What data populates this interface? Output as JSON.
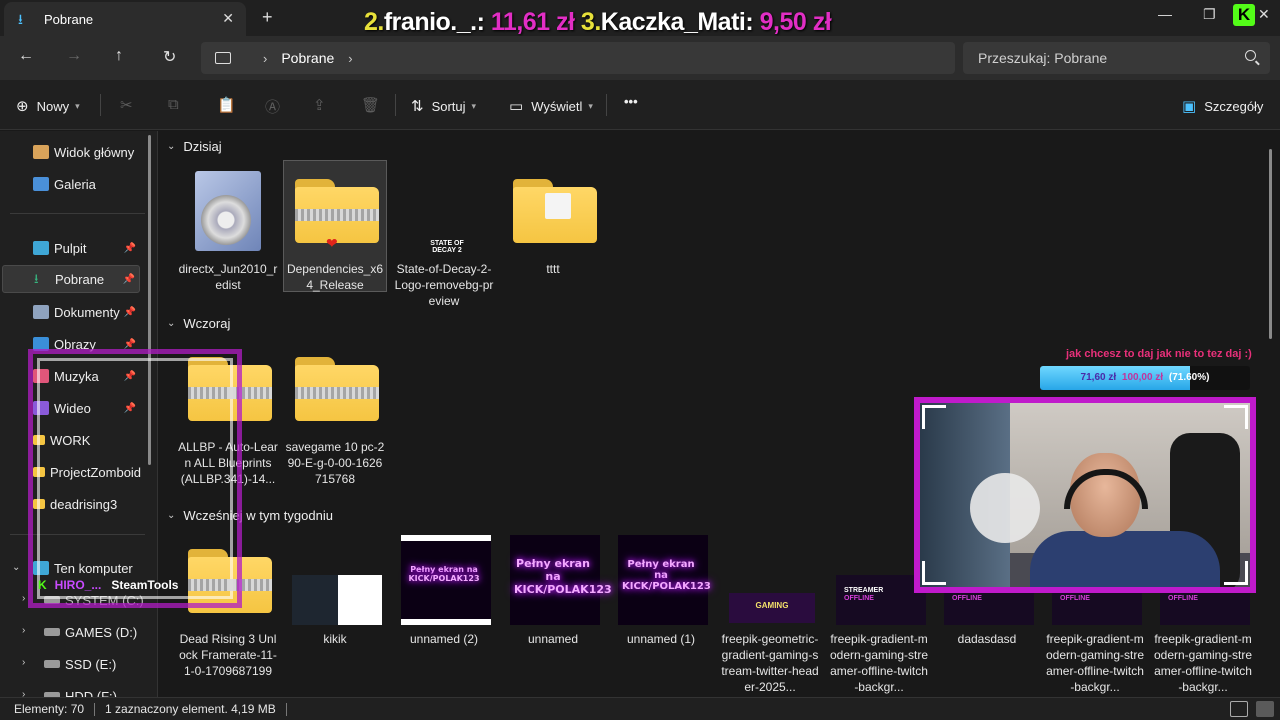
{
  "window": {
    "tab_title": "Pobrane",
    "tab_close": "✕",
    "new_tab": "+"
  },
  "overlay": {
    "donations": [
      {
        "rank": "2.",
        "name": "franio._.:",
        "amount": "11,61 zł"
      },
      {
        "rank": "3.",
        "name": "Kaczka_Mati:",
        "amount": "9,50 zł"
      }
    ],
    "goal_text": "jak chcesz to daj jak nie to tez daj :)",
    "goal_current": "71,60 zł",
    "goal_target": "100,00 zł",
    "goal_percent": "(71.60%)",
    "goal_fraction": 0.716,
    "steam_user": "HIRO_...",
    "steam_label": "SteamTools"
  },
  "address": {
    "crumb": "Pobrane",
    "search_placeholder": "Przeszukaj: Pobrane"
  },
  "toolbar": {
    "new_label": "Nowy",
    "sort_label": "Sortuj",
    "view_label": "Wyświetl",
    "more_label": "•••",
    "details_label": "Szczegóły"
  },
  "sidebar": {
    "items": [
      {
        "label": "Widok główny",
        "icon": "home-icon",
        "color": "#d9a35a"
      },
      {
        "label": "Galeria",
        "icon": "gallery-icon",
        "color": "#4a90d9"
      },
      {
        "label": "Pulpit",
        "icon": "desktop-icon",
        "color": "#3fa7d6",
        "pinned": true
      },
      {
        "label": "Pobrane",
        "icon": "download-icon",
        "color": "#37b37e",
        "pinned": true
      },
      {
        "label": "Dokumenty",
        "icon": "documents-icon",
        "color": "#8fa3bf",
        "pinned": true
      },
      {
        "label": "Obrazy",
        "icon": "pictures-icon",
        "color": "#3a8fd9",
        "pinned": true
      },
      {
        "label": "Muzyka",
        "icon": "music-icon",
        "color": "#e0567a",
        "pinned": true
      },
      {
        "label": "Wideo",
        "icon": "video-icon",
        "color": "#8a5ad9",
        "pinned": true
      },
      {
        "label": "WORK",
        "icon": "folder-icon",
        "color": "#f5c542"
      },
      {
        "label": "ProjectZomboid",
        "icon": "folder-icon",
        "color": "#f5c542"
      },
      {
        "label": "deadrising3",
        "icon": "folder-icon",
        "color": "#f5c542"
      },
      {
        "label": "Ten komputer",
        "icon": "pc-icon",
        "color": "#3fa7d6"
      },
      {
        "label": "SYSTEM (C:)",
        "icon": "drive-icon",
        "color": "#9a9a9a"
      },
      {
        "label": "GAMES (D:)",
        "icon": "drive-icon",
        "color": "#9a9a9a"
      },
      {
        "label": "SSD (E:)",
        "icon": "drive-icon",
        "color": "#9a9a9a"
      },
      {
        "label": "HDD (F:)",
        "icon": "drive-icon",
        "color": "#9a9a9a"
      }
    ]
  },
  "groups": {
    "today": "Dzisiaj",
    "yesterday": "Wczoraj",
    "this_week": "Wcześniej w tym tygodniu"
  },
  "files": {
    "today": [
      "directx_Jun2010_redist",
      "Dependencies_x64_Release",
      "State-of-Decay-2-Logo-removebg-preview",
      "tttt"
    ],
    "yesterday": [
      "ALLBP - Auto-Learn ALL Blueprints (ALLBP.341)-14...",
      "savegame 10 pc-290-E-g-0-00-1626715768"
    ],
    "this_week": [
      "Dead Rising 3 Unlock Framerate-11-1-0-1709687199",
      "kikik",
      "unnamed (2)",
      "unnamed",
      "unnamed (1)",
      "freepik-geometric-gradient-gaming-stream-twitter-header-2025...",
      "freepik-gradient-modern-gaming-streamer-offline-twitch-backgr...",
      "dadasdasd",
      "freepik-gradient-modern-gaming-streamer-offline-twitch-backgr...",
      "freepik-gradient-modern-gaming-streamer-offline-twitch-backgr..."
    ]
  },
  "thumb_text": {
    "state_of_decay": "STATE OF DECAY 2",
    "kick_1": "Pełny ekran na KICK/POLAK123",
    "gaming": "GAMING",
    "streamer": "STREAMER",
    "offline": "OFFLINE"
  },
  "status": {
    "count": "Elementy: 70",
    "selection": "1 zaznaczony element. 4,19 MB"
  }
}
